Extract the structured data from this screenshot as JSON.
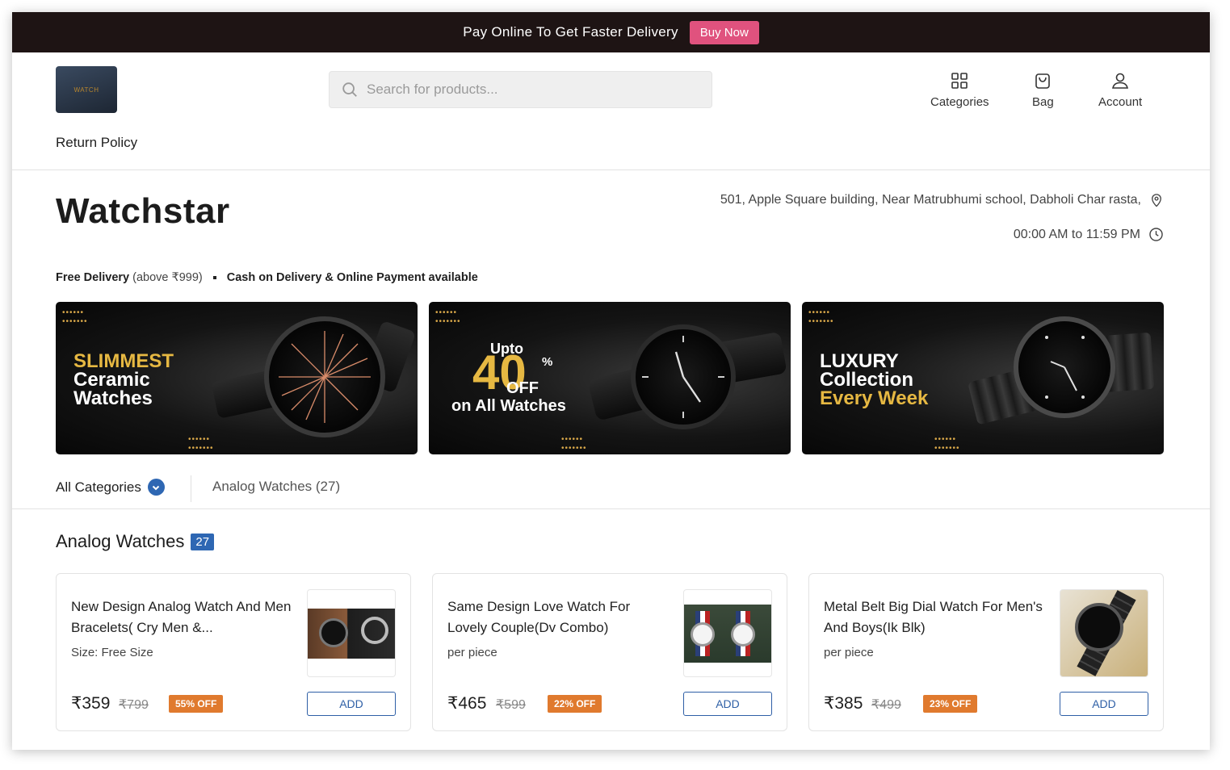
{
  "promo_bar": {
    "text": "Pay Online To Get Faster Delivery",
    "button": "Buy Now"
  },
  "header": {
    "logo_text": "WATCH",
    "search_placeholder": "Search for products...",
    "nav": [
      {
        "label": "Categories",
        "icon": "grid-icon"
      },
      {
        "label": "Bag",
        "icon": "bag-icon"
      },
      {
        "label": "Account",
        "icon": "user-icon"
      }
    ],
    "return_policy": "Return Policy"
  },
  "store": {
    "name": "Watchstar",
    "address": "501, Apple Square building, Near Matrubhumi school, Dabholi Char rasta,",
    "hours": "00:00 AM to 11:59 PM"
  },
  "delivery": {
    "free_delivery": "Free Delivery",
    "threshold": "(above ₹999)",
    "payment": "Cash on Delivery & Online Payment available"
  },
  "banners": [
    {
      "lines": [
        "SLIMMEST",
        "Ceramic",
        "Watches"
      ]
    },
    {
      "lines": [
        "Upto",
        "40",
        "%",
        "OFF",
        "on All Watches"
      ]
    },
    {
      "lines": [
        "LUXURY",
        "Collection",
        "Every Week"
      ]
    }
  ],
  "category_tabs": {
    "all": "All Categories",
    "analog": "Analog Watches (27)"
  },
  "section": {
    "title": "Analog Watches",
    "count": "27"
  },
  "products": [
    {
      "name": "New Design Analog Watch And Men Bracelets( Cry Men &...",
      "sub": "Size: Free Size",
      "price": "₹359",
      "mrp": "₹799",
      "discount": "55% OFF",
      "add": "ADD"
    },
    {
      "name": "Same Design Love Watch For Lovely Couple(Dv Combo)",
      "sub": "per piece",
      "price": "₹465",
      "mrp": "₹599",
      "discount": "22% OFF",
      "add": "ADD"
    },
    {
      "name": "Metal Belt Big Dial Watch For Men's And Boys(Ik Blk)",
      "sub": "per piece",
      "price": "₹385",
      "mrp": "₹499",
      "discount": "23% OFF",
      "add": "ADD"
    }
  ],
  "colors": {
    "promo_bg": "#1e1414",
    "buy_now": "#e0527e",
    "accent_blue": "#2e67b3",
    "discount_orange": "#e07a2e",
    "banner_gold": "#e6b842"
  }
}
